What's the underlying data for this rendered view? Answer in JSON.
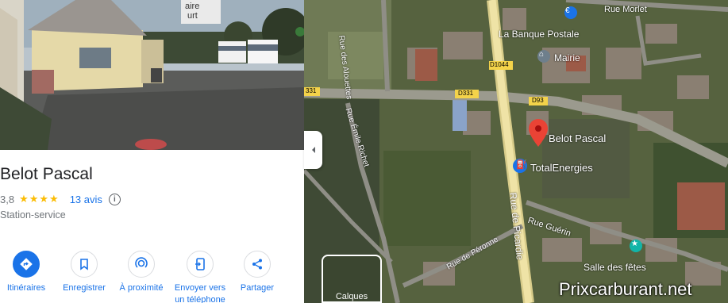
{
  "place": {
    "name": "Belot Pascal",
    "rating": "3,8",
    "stars": "★★★★",
    "reviews": "13 avis",
    "category": "Station-service"
  },
  "actions": [
    {
      "label": "Itinéraires",
      "icon": "directions-icon"
    },
    {
      "label": "Enregistrer",
      "icon": "bookmark-icon"
    },
    {
      "label": "À proximité",
      "icon": "nearby-icon"
    },
    {
      "label": "Envoyer vers un téléphone",
      "icon": "phone-icon"
    },
    {
      "label": "Partager",
      "icon": "share-icon"
    }
  ],
  "map": {
    "streets": {
      "rue_morlet": "Rue Morlet",
      "alouettes": "Rue des Alouettes",
      "emile_richet": "Rue Émile Richet",
      "picardie": "Rue de Picardie",
      "peronne": "Rue de Péronne",
      "guerin": "Rue Guérin"
    },
    "roads": {
      "d1044": "D1044",
      "d331": "D331",
      "d331_left": "331",
      "d93": "D93"
    },
    "pois": {
      "banque": "La Banque Postale",
      "mairie": "Mairie",
      "marker": "Belot Pascal",
      "total": "TotalEnergies",
      "salle": "Salle des fêtes"
    },
    "photo_sign": {
      "line1": "aire",
      "line2": "urt"
    },
    "layer_label": "Calques"
  },
  "watermark": "Prixcarburant.net",
  "colors": {
    "accent": "#1a73e8",
    "marker": "#ea4335",
    "stars": "#fbbc04"
  }
}
